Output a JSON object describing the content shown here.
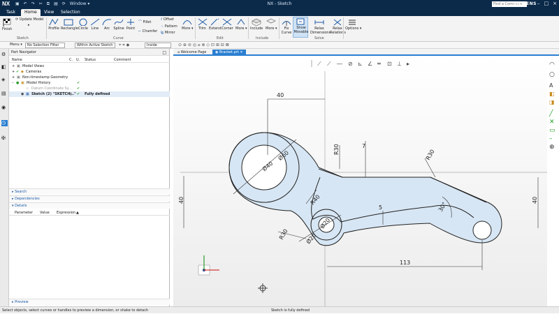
{
  "titlebar": {
    "logo": "NX",
    "window_menu": "Window ▾",
    "title": "NX - Sketch",
    "brand": "SIEMENS",
    "search_placeholder": "Find a Command"
  },
  "menu": {
    "tabs": [
      "Task",
      "Home",
      "View",
      "Selection"
    ],
    "active": "Home"
  },
  "ribbon": {
    "finish": "Finish",
    "update_model": "Update Model",
    "sketch_group": "Sketch",
    "profile": "Profile",
    "rectangle": "Rectangle",
    "circle": "Circle",
    "line": "Line",
    "arc": "Arc",
    "spline": "Spline",
    "point": "Point",
    "fillet": "Fillet",
    "chamfer": "Chamfer",
    "offset": "Offset",
    "pattern": "Pattern",
    "mirror": "Mirror",
    "curve_group": "Curve",
    "more1": "More",
    "trim": "Trim",
    "extend": "Extend",
    "corner": "Corner",
    "more2": "More",
    "edit_group": "Edit",
    "include": "Include",
    "more3": "More",
    "include_group": "Include",
    "fix_curve": "Fix Curve",
    "show_movable": "Show Movable",
    "relax_dimensions": "Relax Dimensions",
    "relax_relations": "Relax Relations",
    "solve_group": "Solve",
    "options": "Options"
  },
  "selection_bar": {
    "menu": "Menu ▾",
    "filter": "No Selection Filter",
    "scope": "Within Active Sketch ...",
    "mode": "Inside"
  },
  "navigator": {
    "title": "Part Navigator",
    "columns": [
      "Name",
      "C.",
      "U.",
      "Status",
      "Comment"
    ],
    "tree": [
      {
        "label": "Model Views",
        "indent": 0
      },
      {
        "label": "Cameras",
        "indent": 0
      },
      {
        "label": "Non-timestamp Geometry",
        "indent": 0
      },
      {
        "label": "Model History",
        "indent": 0
      },
      {
        "label": "Datum Coordinate Sy...",
        "indent": 1
      },
      {
        "label": "Sketch (2) \"SKETCH...\"",
        "indent": 1,
        "status": "Fully defined"
      }
    ],
    "sections": {
      "search": "Search",
      "dependencies": "Dependencies",
      "details": "Details",
      "preview": "Preview"
    },
    "details_columns": [
      "Parameter",
      "Value",
      "Expression"
    ]
  },
  "doc_tabs": {
    "welcome": "Welcome Page",
    "file": "Bracket.prt"
  },
  "sketch": {
    "dims": {
      "d40_top": "40",
      "phi40": "Ø40",
      "phi60": "Ø60",
      "r30_top": "R30",
      "d7": "7",
      "r30_right": "R30",
      "d40_left": "40",
      "d40_right": "40",
      "r40": "R40",
      "d5": "5",
      "a30": "30°",
      "r30_bottom": "R30",
      "phi20a": "Ø20",
      "phi20b": "Ø20",
      "d113": "113"
    }
  },
  "status": {
    "left": "Select objects, select curves or handles to preview a dimension, or shake to detach",
    "center": "Sketch is fully defined"
  },
  "colors": {
    "titlebar": "#0b2a4a",
    "accent": "#2a7fd1",
    "sketch_fill": "#d7e6f4",
    "check": "#2a9d2a"
  }
}
